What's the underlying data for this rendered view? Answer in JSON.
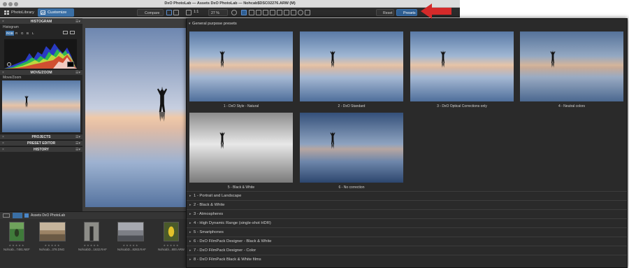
{
  "window": {
    "title": "DxO PhotoLab — Assets DxO PhotoLab — Nohcab$DSC02276.ARW (M)"
  },
  "toolbar": {
    "tabs": [
      {
        "label": "PhotoLibrary",
        "icon": "grid-icon"
      },
      {
        "label": "Customize",
        "icon": "customize-icon"
      }
    ],
    "compare_label": "Compare",
    "zoom_ratio": "1:1",
    "zoom_percent": "27 %",
    "reset_label": "Reset",
    "presets_label": "Presets"
  },
  "left_panel": {
    "histogram_title": "HISTOGRAM",
    "histogram_sub": "Histogram",
    "channels": [
      "RGB",
      "R",
      "G",
      "B",
      "L"
    ],
    "move_zoom_title": "MOVE/ZOOM",
    "move_zoom_sub": "Move/Zoom",
    "projects_title": "PROJECTS",
    "preset_editor_title": "PRESET EDITOR",
    "history_title": "HISTORY"
  },
  "filmstrip": {
    "folder_label": "Assets DxO PhotoLab",
    "thumbs": [
      {
        "name": "Nohcab...7481.NEF",
        "stars": "★★★★★"
      },
      {
        "name": "Nohcab...378.DNG",
        "stars": "★★★★★"
      },
      {
        "name": "NohcabD...1632.RAF",
        "stars": "★★★★★"
      },
      {
        "name": "NohcabD...8283.RAF",
        "stars": "★★★★★"
      },
      {
        "name": "Nohcab\\...800.ARW",
        "stars": "★★★★★"
      }
    ]
  },
  "presets": {
    "section_title": "General purpose presets",
    "cards": [
      {
        "label": "1 - DxO Style - Natural",
        "variant": "natural"
      },
      {
        "label": "2 - DxO Standard",
        "variant": "standard"
      },
      {
        "label": "3 - DxO Optical Corrections only",
        "variant": "optical"
      },
      {
        "label": "4 - Neutral colors",
        "variant": "neutral"
      },
      {
        "label": "5 - Black & White",
        "variant": "bw"
      },
      {
        "label": "6 - No correction",
        "variant": "nocorr"
      }
    ],
    "categories": [
      "1 - Portrait and Landscape",
      "2 - Black & White",
      "3 - Atmospheres",
      "4 - High Dynamic Range (single-shot HDR)",
      "5 - Smartphones",
      "6 - DxO FilmPack Designer - Black & White",
      "7 - DxO FilmPack Designer - Color",
      "8 - DxO FilmPack Black & White films"
    ]
  },
  "colors": {
    "accent": "#3a6fa5",
    "annotation_arrow": "#d42a2a"
  }
}
